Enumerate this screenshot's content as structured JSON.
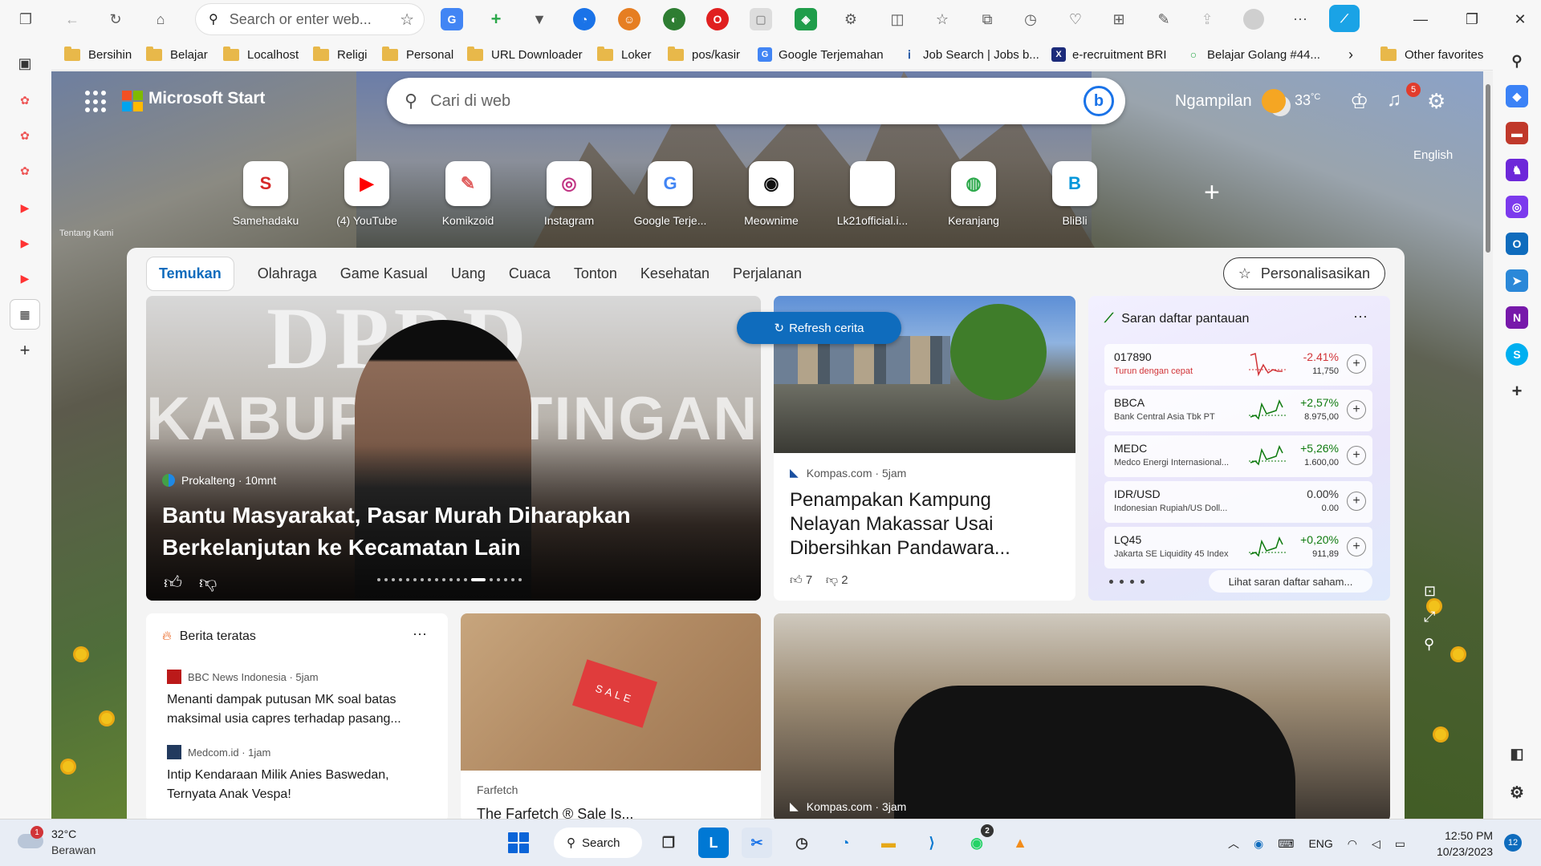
{
  "browser": {
    "address_placeholder": "Search or enter web...",
    "bookmarks": [
      {
        "label": "Bersihin",
        "type": "folder"
      },
      {
        "label": "Belajar",
        "type": "folder"
      },
      {
        "label": "Localhost",
        "type": "folder"
      },
      {
        "label": "Religi",
        "type": "folder"
      },
      {
        "label": "Personal",
        "type": "folder"
      },
      {
        "label": "URL Downloader",
        "type": "folder"
      },
      {
        "label": "Loker",
        "type": "folder"
      },
      {
        "label": "pos/kasir",
        "type": "folder"
      },
      {
        "label": "Google Terjemahan",
        "type": "site"
      },
      {
        "label": "Job Search | Jobs b...",
        "type": "site"
      },
      {
        "label": "e-recruitment BRI",
        "type": "site"
      },
      {
        "label": "Belajar Golang #44...",
        "type": "site"
      }
    ],
    "other_favorites": "Other favorites"
  },
  "header": {
    "brand": "Microsoft Start",
    "search_placeholder": "Cari di web",
    "location": "Ngampilan",
    "temperature": "33",
    "temperature_unit": "°C",
    "notification_count": "5",
    "language": "English",
    "about": "Tentang Kami"
  },
  "quick_links": [
    {
      "label": "Samehadaku",
      "glyph": "S",
      "color": "#d62828"
    },
    {
      "label": "(4) YouTube",
      "glyph": "▶",
      "color": "#ff0000"
    },
    {
      "label": "Komikzoid",
      "glyph": "✎",
      "color": "#e05c5c"
    },
    {
      "label": "Instagram",
      "glyph": "◎",
      "color": "#c13584"
    },
    {
      "label": "Google Terje...",
      "glyph": "G",
      "color": "#4285f4"
    },
    {
      "label": "Meownime",
      "glyph": "◉",
      "color": "#111111"
    },
    {
      "label": "Lk21official.i...",
      "glyph": "",
      "color": "#ffffff"
    },
    {
      "label": "Keranjang",
      "glyph": "◍",
      "color": "#2ba84a"
    },
    {
      "label": "BliBli",
      "glyph": "B",
      "color": "#0095da"
    }
  ],
  "feed": {
    "tabs": [
      "Temukan",
      "Olahraga",
      "Game Kasual",
      "Uang",
      "Cuaca",
      "Tonton",
      "Kesehatan",
      "Perjalanan"
    ],
    "personalize": "Personalisasikan",
    "refresh": "Refresh cerita",
    "hero": {
      "photo_text_1": "DPRD",
      "photo_text_2": "KABUPA    KATINGAN",
      "source": "Prokalteng",
      "time": "10mnt",
      "title": "Bantu Masyarakat, Pasar Murah Diharapkan Berkelanjutan ke Kecamatan Lain"
    },
    "story2": {
      "source": "Kompas.com",
      "time": "5jam",
      "title": "Penampakan Kampung Nelayan Makassar Usai Dibersihkan Pandawara...",
      "likes": "7",
      "dislikes": "2"
    },
    "watchlist": {
      "title": "Saran daftar pantauan",
      "see_more": "Lihat saran daftar saham...",
      "items": [
        {
          "symbol": "017890",
          "name": "Turun dengan cepat",
          "change": "-2.41%",
          "price": "11,750",
          "dir": "down"
        },
        {
          "symbol": "BBCA",
          "name": "Bank Central Asia Tbk PT",
          "change": "+2,57%",
          "price": "8.975,00",
          "dir": "up"
        },
        {
          "symbol": "MEDC",
          "name": "Medco Energi Internasional...",
          "change": "+5,26%",
          "price": "1.600,00",
          "dir": "up"
        },
        {
          "symbol": "IDR/USD",
          "name": "Indonesian Rupiah/US Doll...",
          "change": "0.00%",
          "price": "0.00",
          "dir": "flat"
        },
        {
          "symbol": "LQ45",
          "name": "Jakarta SE Liquidity 45 Index",
          "change": "+0,20%",
          "price": "911,89",
          "dir": "up"
        }
      ]
    },
    "top_news": {
      "title": "Berita teratas",
      "items": [
        {
          "source": "BBC News Indonesia",
          "time": "5jam",
          "title": "Menanti dampak putusan MK soal batas maksimal usia capres terhadap pasang..."
        },
        {
          "source": "Medcom.id",
          "time": "1jam",
          "title": "Intip Kendaraan Milik Anies Baswedan, Ternyata Anak Vespa!"
        }
      ]
    },
    "farfetch": {
      "sale_tag": "SALE",
      "source": "Farfetch",
      "title": "The Farfetch ® Sale Is..."
    },
    "car": {
      "source": "Kompas.com",
      "time": "3jam"
    }
  },
  "taskbar": {
    "weather_temp": "32°C",
    "weather_cond": "Berawan",
    "weather_badge": "1",
    "search": "Search",
    "whatsapp_badge": "2",
    "lang": "ENG",
    "time": "12:50 PM",
    "date": "10/23/2023",
    "notifications": "12"
  },
  "colors": {
    "accent": "#0f6cbd",
    "up": "#0f7b0f",
    "down": "#d13438"
  }
}
